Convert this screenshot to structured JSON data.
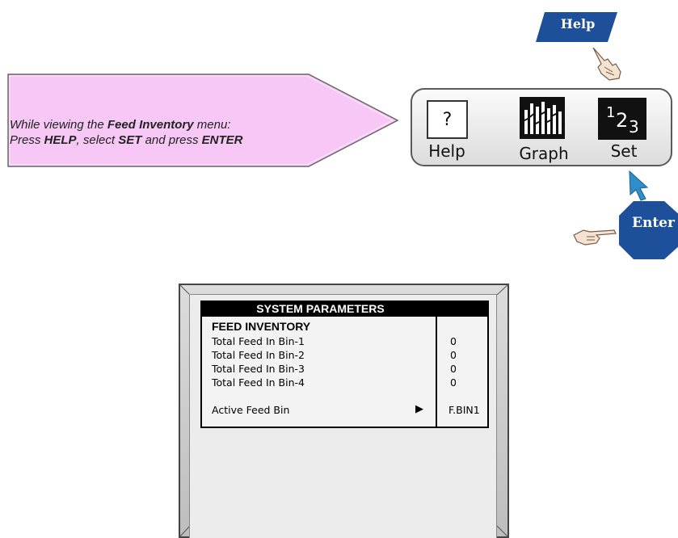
{
  "instruction": {
    "line1_prefix": "While viewing the ",
    "line1_bold": "Feed Inventory",
    "line1_suffix": " menu:",
    "line2_a": "Press ",
    "line2_b": "HELP",
    "line2_c": ", select ",
    "line2_d": "SET",
    "line2_e": " and press ",
    "line2_f": "ENTER",
    "fill_color": "#f7c8f5"
  },
  "help_badge": {
    "label": "Help",
    "color": "#1d4f9a"
  },
  "keys": {
    "help": {
      "symbol": "?",
      "label": "Help"
    },
    "graph": {
      "label": "Graph"
    },
    "set": {
      "symbol_1": "1",
      "symbol_2": "2",
      "symbol_3": "3",
      "label": "Set"
    }
  },
  "enter_badge": {
    "label": "Enter",
    "color": "#1d4f9a"
  },
  "arrow_color": "#2d8ec9",
  "screen": {
    "header": "SYSTEM PARAMETERS",
    "section": "FEED INVENTORY",
    "rows": [
      {
        "label": "Total Feed In Bin-1",
        "value": "0"
      },
      {
        "label": "Total Feed In Bin-2",
        "value": "0"
      },
      {
        "label": "Total Feed In Bin-3",
        "value": "0"
      },
      {
        "label": "Total Feed In Bin-4",
        "value": "0"
      }
    ],
    "active_bin": {
      "label": "Active Feed Bin",
      "pointer": "▶",
      "value": "F.BIN1"
    }
  }
}
